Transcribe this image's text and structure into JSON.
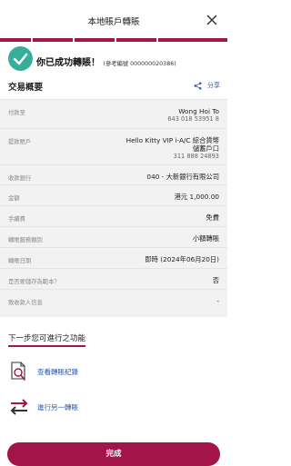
{
  "header": {
    "title": "本地賬戶轉賬"
  },
  "colors": {
    "accent": "#a31449",
    "success": "#35ae9a",
    "link": "#2a55a5"
  },
  "success": {
    "message": "你已成功轉賬！",
    "reference": "(參考編號 000000020386)"
  },
  "summary": {
    "title": "交易概要",
    "share_label": "分享"
  },
  "details": [
    {
      "label": "付款至",
      "lines": [
        "Wong Hoi To",
        "643 018 53951 8"
      ]
    },
    {
      "label": "提款賬戶",
      "lines": [
        "Hello Kitty VIP i-A/C 綜合貨幣",
        "儲蓄戶口",
        "311 888 24893"
      ]
    },
    {
      "label": "收款銀行",
      "lines": [
        "040 - 大新銀行有限公司"
      ]
    },
    {
      "label": "金額",
      "lines": [
        "港元 1,000.00"
      ]
    },
    {
      "label": "手續費",
      "lines": [
        "免費"
      ]
    },
    {
      "label": "轉賬服務類別",
      "lines": [
        "小額轉賬"
      ]
    },
    {
      "label": "轉賬日期",
      "lines": [
        "即時 (2024年06月20日)"
      ]
    },
    {
      "label": "是否要儲存為範本？",
      "lines": [
        "否"
      ]
    },
    {
      "label": "致收款人信息",
      "lines": [
        "-"
      ]
    }
  ],
  "next_steps": {
    "title": "下一步您可進行之功能",
    "actions": [
      {
        "label": "查看轉賬紀錄",
        "icon": "search-document-icon"
      },
      {
        "label": "進行另一轉賬",
        "icon": "transfer-arrows-icon"
      }
    ]
  },
  "done_label": "完成"
}
